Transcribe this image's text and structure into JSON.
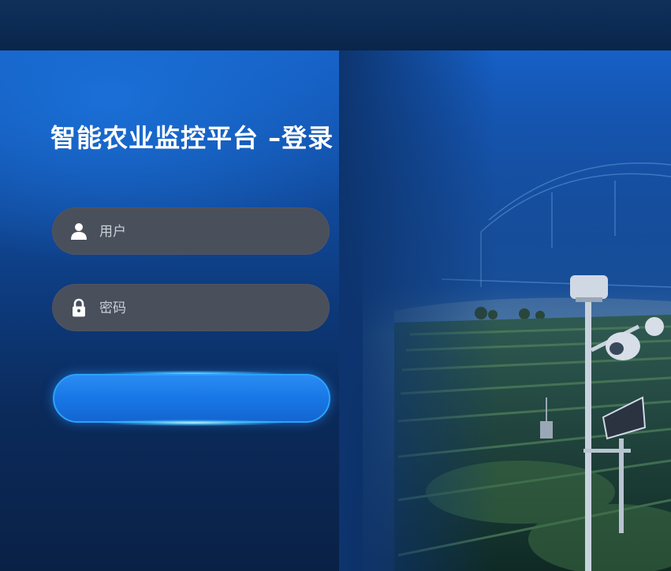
{
  "page": {
    "title": "智能农业监控平台 –登录"
  },
  "login_form": {
    "username": {
      "placeholder": "用户",
      "value": "",
      "icon": "user-icon"
    },
    "password": {
      "placeholder": "密码",
      "value": "",
      "icon": "lock-icon"
    },
    "submit_label": ""
  },
  "colors": {
    "accent": "#1877e6",
    "panel_top": "#1660c7",
    "panel_bottom": "#0a2146",
    "field_bg": "#4a4f5c",
    "title_text": "#ffffff"
  }
}
